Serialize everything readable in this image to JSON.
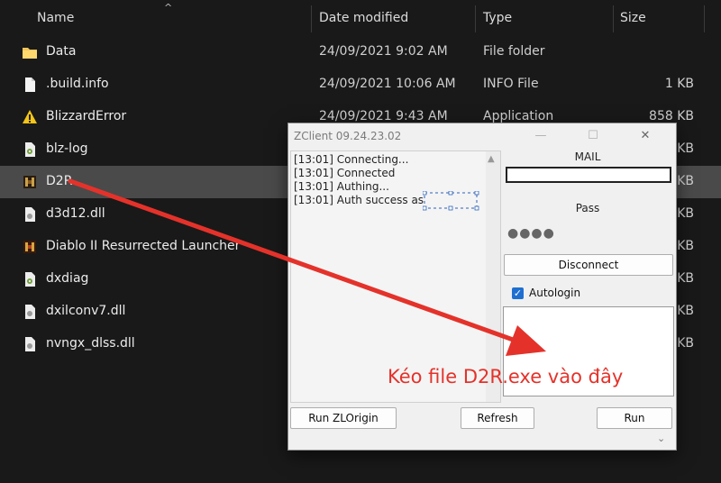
{
  "explorer": {
    "columns": {
      "name": "Name",
      "date": "Date modified",
      "type": "Type",
      "size": "Size"
    },
    "rows": [
      {
        "name": "Data",
        "date": "24/09/2021 9:02 AM",
        "type": "File folder",
        "size": "",
        "icon": "folder-icon"
      },
      {
        "name": ".build.info",
        "date": "24/09/2021 10:06 AM",
        "type": "INFO File",
        "size": "1 KB",
        "icon": "file-icon"
      },
      {
        "name": "BlizzardError",
        "date": "24/09/2021 9:43 AM",
        "type": "Application",
        "size": "858 KB",
        "icon": "warning-icon"
      },
      {
        "name": "blz-log",
        "date": "",
        "type": "",
        "size": "5 KB",
        "icon": "settings-file-icon"
      },
      {
        "name": "D2R",
        "date": "",
        "type": "",
        "size": "5 KB",
        "icon": "d2r-icon"
      },
      {
        "name": "d3d12.dll",
        "date": "",
        "type": "",
        "size": "3 KB",
        "icon": "dll-icon"
      },
      {
        "name": "Diablo II Resurrected Launcher",
        "date": "",
        "type": "",
        "size": "2 KB",
        "icon": "d2r-launcher-icon"
      },
      {
        "name": "dxdiag",
        "date": "",
        "type": "",
        "size": "3 KB",
        "icon": "settings-file-icon"
      },
      {
        "name": "dxilconv7.dll",
        "date": "",
        "type": "",
        "size": "0 KB",
        "icon": "dll-icon"
      },
      {
        "name": "nvngx_dlss.dll",
        "date": "",
        "type": "",
        "size": "0 KB",
        "icon": "dll-icon"
      }
    ]
  },
  "dialog": {
    "title": "ZClient 09.24.23.02",
    "log": [
      "[13:01] Connecting...",
      "[13:01] Connected",
      "[13:01] Authing...",
      "[13:01] Auth success as"
    ],
    "mail_label": "MAIL",
    "mail_value": "",
    "pass_label": "Pass",
    "pass_mask": "●●●●",
    "disconnect_label": "Disconnect",
    "autologin_label": "Autologin",
    "autologin_checked": true,
    "run_zlorigin_label": "Run ZLOrigin",
    "refresh_label": "Refresh",
    "run_label": "Run"
  },
  "annotation": {
    "caption": "Kéo file D2R.exe vào đây",
    "color": "#e4322a"
  }
}
